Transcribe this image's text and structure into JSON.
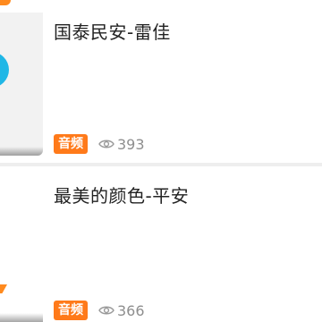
{
  "items": [
    {
      "title": "国泰民安-雷佳",
      "badge": "音频",
      "views": "393"
    },
    {
      "title": "最美的颜色-平安",
      "badge": "音频",
      "views": "366"
    }
  ],
  "colors": {
    "badge_bg": "#ff7a1a",
    "title": "#222222",
    "meta": "#8e8e8e",
    "thumb_accent": "#20b7e6"
  },
  "icons": {
    "views": "eye-icon"
  }
}
